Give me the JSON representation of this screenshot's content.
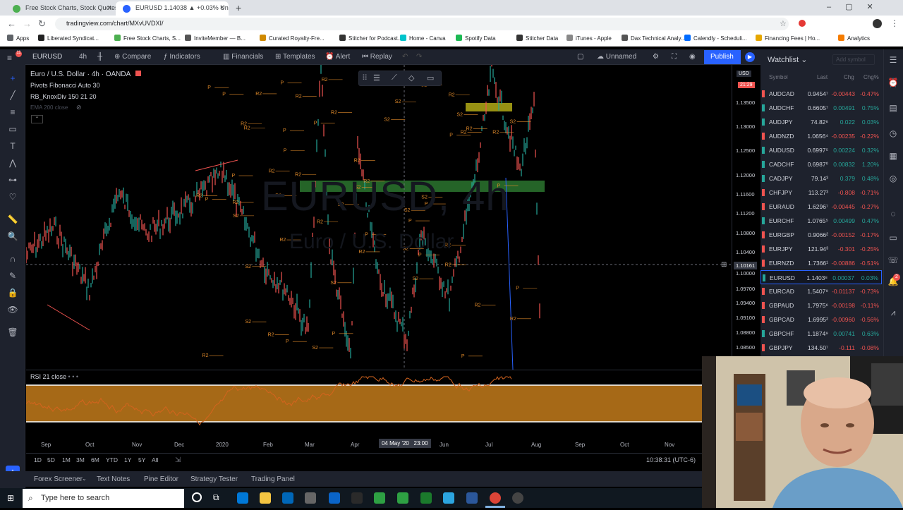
{
  "browser": {
    "tabs": [
      {
        "title": "Free Stock Charts, Stock Quotes a",
        "active": false
      },
      {
        "title": "EURUSD 1.14038 ▲ +0.03% Unn",
        "active": true
      }
    ],
    "url": "tradingview.com/chart/MXvUVDXI/",
    "bookmarks": [
      "Apps",
      "Liberated Syndicat...",
      "Free Stock Charts, S...",
      "InviteMember — B...",
      "Curated Royalty-Fre...",
      "Stitcher for Podcast...",
      "Home - Canva",
      "Spotify Data",
      "Stitcher Data",
      "iTunes - Apple",
      "Dax Technical Analy...",
      "Calendly - Scheduli...",
      "Financing Fees | Ho...",
      "Analytics"
    ]
  },
  "toolbar": {
    "symbol": "EURUSD",
    "interval": "4h",
    "compare": "Compare",
    "indicators": "Indicators",
    "financials": "Financials",
    "templates": "Templates",
    "alert": "Alert",
    "replay": "Replay",
    "layout_name": "Unnamed",
    "publish": "Publish"
  },
  "chart": {
    "title": "Euro / U.S. Dollar",
    "interval": "4h",
    "exchange": "OANDA",
    "indicators": [
      "Pivots Fibonacci Auto 30",
      "RB_KnoxDiv 150 21 20",
      "EMA 200 close"
    ],
    "watermark_symbol": "EURUSD, 4h",
    "watermark_name": "Euro / U.S. Dollar",
    "currency": "USD",
    "countdown": "21:29",
    "crosshair_price": "1.10161",
    "price_ticks": [
      "1.13500",
      "1.13000",
      "1.12500",
      "1.12000",
      "1.11600",
      "1.11200",
      "1.10800",
      "1.10400",
      "1.10000",
      "1.09700",
      "1.09400",
      "1.09100",
      "1.08800",
      "1.08500"
    ],
    "rsi_label": "RSI 21 close",
    "time_ticks": [
      "Sep",
      "Oct",
      "Nov",
      "Dec",
      "2020",
      "Feb",
      "Mar",
      "Apr",
      "Jun",
      "Jul",
      "Aug",
      "Sep",
      "Oct",
      "Nov"
    ],
    "crosshair_time": "04 May '20   23:00",
    "ranges": [
      "1D",
      "5D",
      "1M",
      "3M",
      "6M",
      "YTD",
      "1Y",
      "5Y",
      "All"
    ],
    "clock": "10:38:31 (UTC-6)",
    "pivot_labels": [
      "R2",
      "S2",
      "P"
    ]
  },
  "bottom_tabs": [
    "Forex Screener",
    "Text Notes",
    "Pine Editor",
    "Strategy Tester",
    "Trading Panel"
  ],
  "watchlist": {
    "title": "Watchlist",
    "add_placeholder": "Add symbol",
    "columns": [
      "Symbol",
      "Last",
      "Chg",
      "Chg%"
    ],
    "rows": [
      {
        "symbol": "AUDCAD",
        "last": "0.9454⁷",
        "chg": "-0.00443",
        "pct": "-0.47%",
        "up": false
      },
      {
        "symbol": "AUDCHF",
        "last": "0.6605⁷",
        "chg": "0.00491",
        "pct": "0.75%",
        "up": true
      },
      {
        "symbol": "AUDJPY",
        "last": "74.82⁸",
        "chg": "0.022",
        "pct": "0.03%",
        "up": true
      },
      {
        "symbol": "AUDNZD",
        "last": "1.0656⁴",
        "chg": "-0.00235",
        "pct": "-0.22%",
        "up": false
      },
      {
        "symbol": "AUDUSD",
        "last": "0.6997⁵",
        "chg": "0.00224",
        "pct": "0.32%",
        "up": true
      },
      {
        "symbol": "CADCHF",
        "last": "0.6987⁰",
        "chg": "0.00832",
        "pct": "1.20%",
        "up": true
      },
      {
        "symbol": "CADJPY",
        "last": "79.14³",
        "chg": "0.379",
        "pct": "0.48%",
        "up": true
      },
      {
        "symbol": "CHFJPY",
        "last": "113.27³",
        "chg": "-0.808",
        "pct": "-0.71%",
        "up": false
      },
      {
        "symbol": "EURAUD",
        "last": "1.6296⁷",
        "chg": "-0.00445",
        "pct": "-0.27%",
        "up": false
      },
      {
        "symbol": "EURCHF",
        "last": "1.0765⁵",
        "chg": "0.00499",
        "pct": "0.47%",
        "up": true
      },
      {
        "symbol": "EURGBP",
        "last": "0.9066²",
        "chg": "-0.00152",
        "pct": "-0.17%",
        "up": false
      },
      {
        "symbol": "EURJPY",
        "last": "121.94³",
        "chg": "-0.301",
        "pct": "-0.25%",
        "up": false
      },
      {
        "symbol": "EURNZD",
        "last": "1.7366¹",
        "chg": "-0.00886",
        "pct": "-0.51%",
        "up": false
      },
      {
        "symbol": "EURUSD",
        "last": "1.1403⁸",
        "chg": "0.00037",
        "pct": "0.03%",
        "up": true
      },
      {
        "symbol": "EURCAD",
        "last": "1.5407⁹",
        "chg": "-0.01137",
        "pct": "-0.73%",
        "up": false
      },
      {
        "symbol": "GBPAUD",
        "last": "1.7975⁶",
        "chg": "-0.00198",
        "pct": "-0.11%",
        "up": false
      },
      {
        "symbol": "GBPCAD",
        "last": "1.6995²",
        "chg": "-0.00960",
        "pct": "-0.56%",
        "up": false
      },
      {
        "symbol": "GBPCHF",
        "last": "1.1874⁹",
        "chg": "0.00741",
        "pct": "0.63%",
        "up": true
      },
      {
        "symbol": "GBPJPY",
        "last": "134.50⁷",
        "chg": "-0.111",
        "pct": "-0.08%",
        "up": false
      }
    ]
  },
  "taskbar": {
    "search_placeholder": "Type here to search"
  },
  "colors": {
    "up": "#26a69a",
    "down": "#ef5350",
    "publish": "#2962ff",
    "rsi_fill": "#b8741a",
    "zone_green": "#2e7d32",
    "zone_yellow": "#c9c21a"
  }
}
